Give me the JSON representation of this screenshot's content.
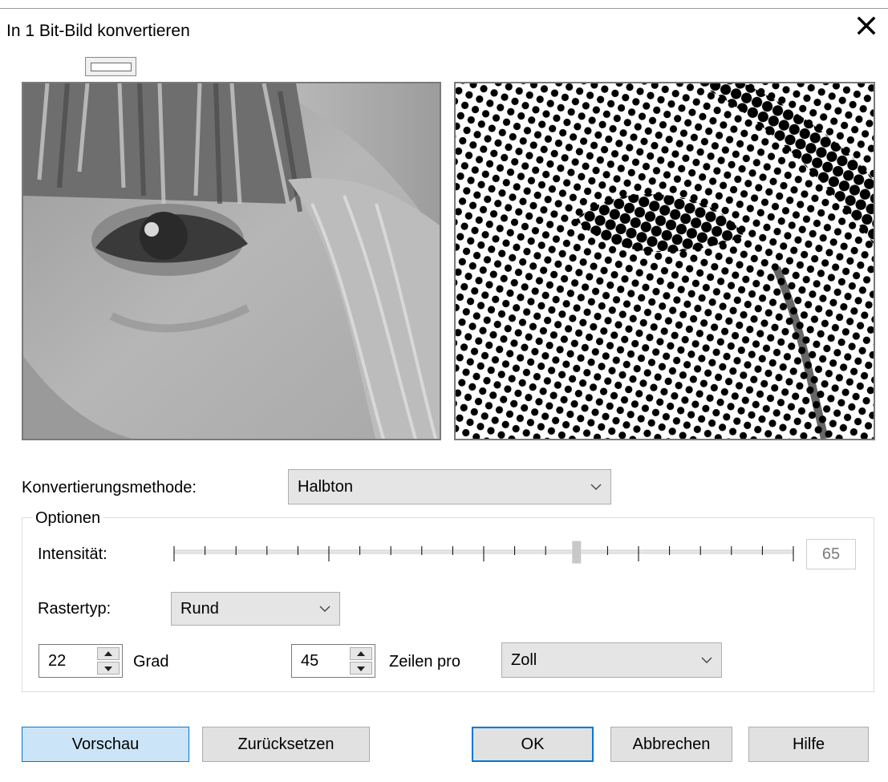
{
  "window": {
    "title": "In 1 Bit-Bild konvertieren"
  },
  "icons": {
    "close": "close-icon",
    "dropdown": "chevron-down-icon",
    "spin_up": "spin-up-icon",
    "spin_down": "spin-down-icon"
  },
  "conversion": {
    "label": "Konvertierungsmethode:",
    "selected": "Halbton"
  },
  "options": {
    "legend": "Optionen",
    "intensity": {
      "label": "Intensität:",
      "value": "65",
      "min": 0,
      "max": 100,
      "level": 65
    },
    "raster": {
      "label": "Rastertyp:",
      "selected": "Rund"
    },
    "angle": {
      "value": "22",
      "unit_label": "Grad"
    },
    "lines": {
      "value": "45",
      "label": "Zeilen pro",
      "unit_selected": "Zoll"
    }
  },
  "buttons": {
    "preview": "Vorschau",
    "reset": "Zurücksetzen",
    "ok": "OK",
    "cancel": "Abbrechen",
    "help": "Hilfe"
  },
  "colors": {
    "accent": "#0078d7",
    "preview_button_bg": "#cce4f7",
    "button_bg": "#e1e1e1"
  }
}
